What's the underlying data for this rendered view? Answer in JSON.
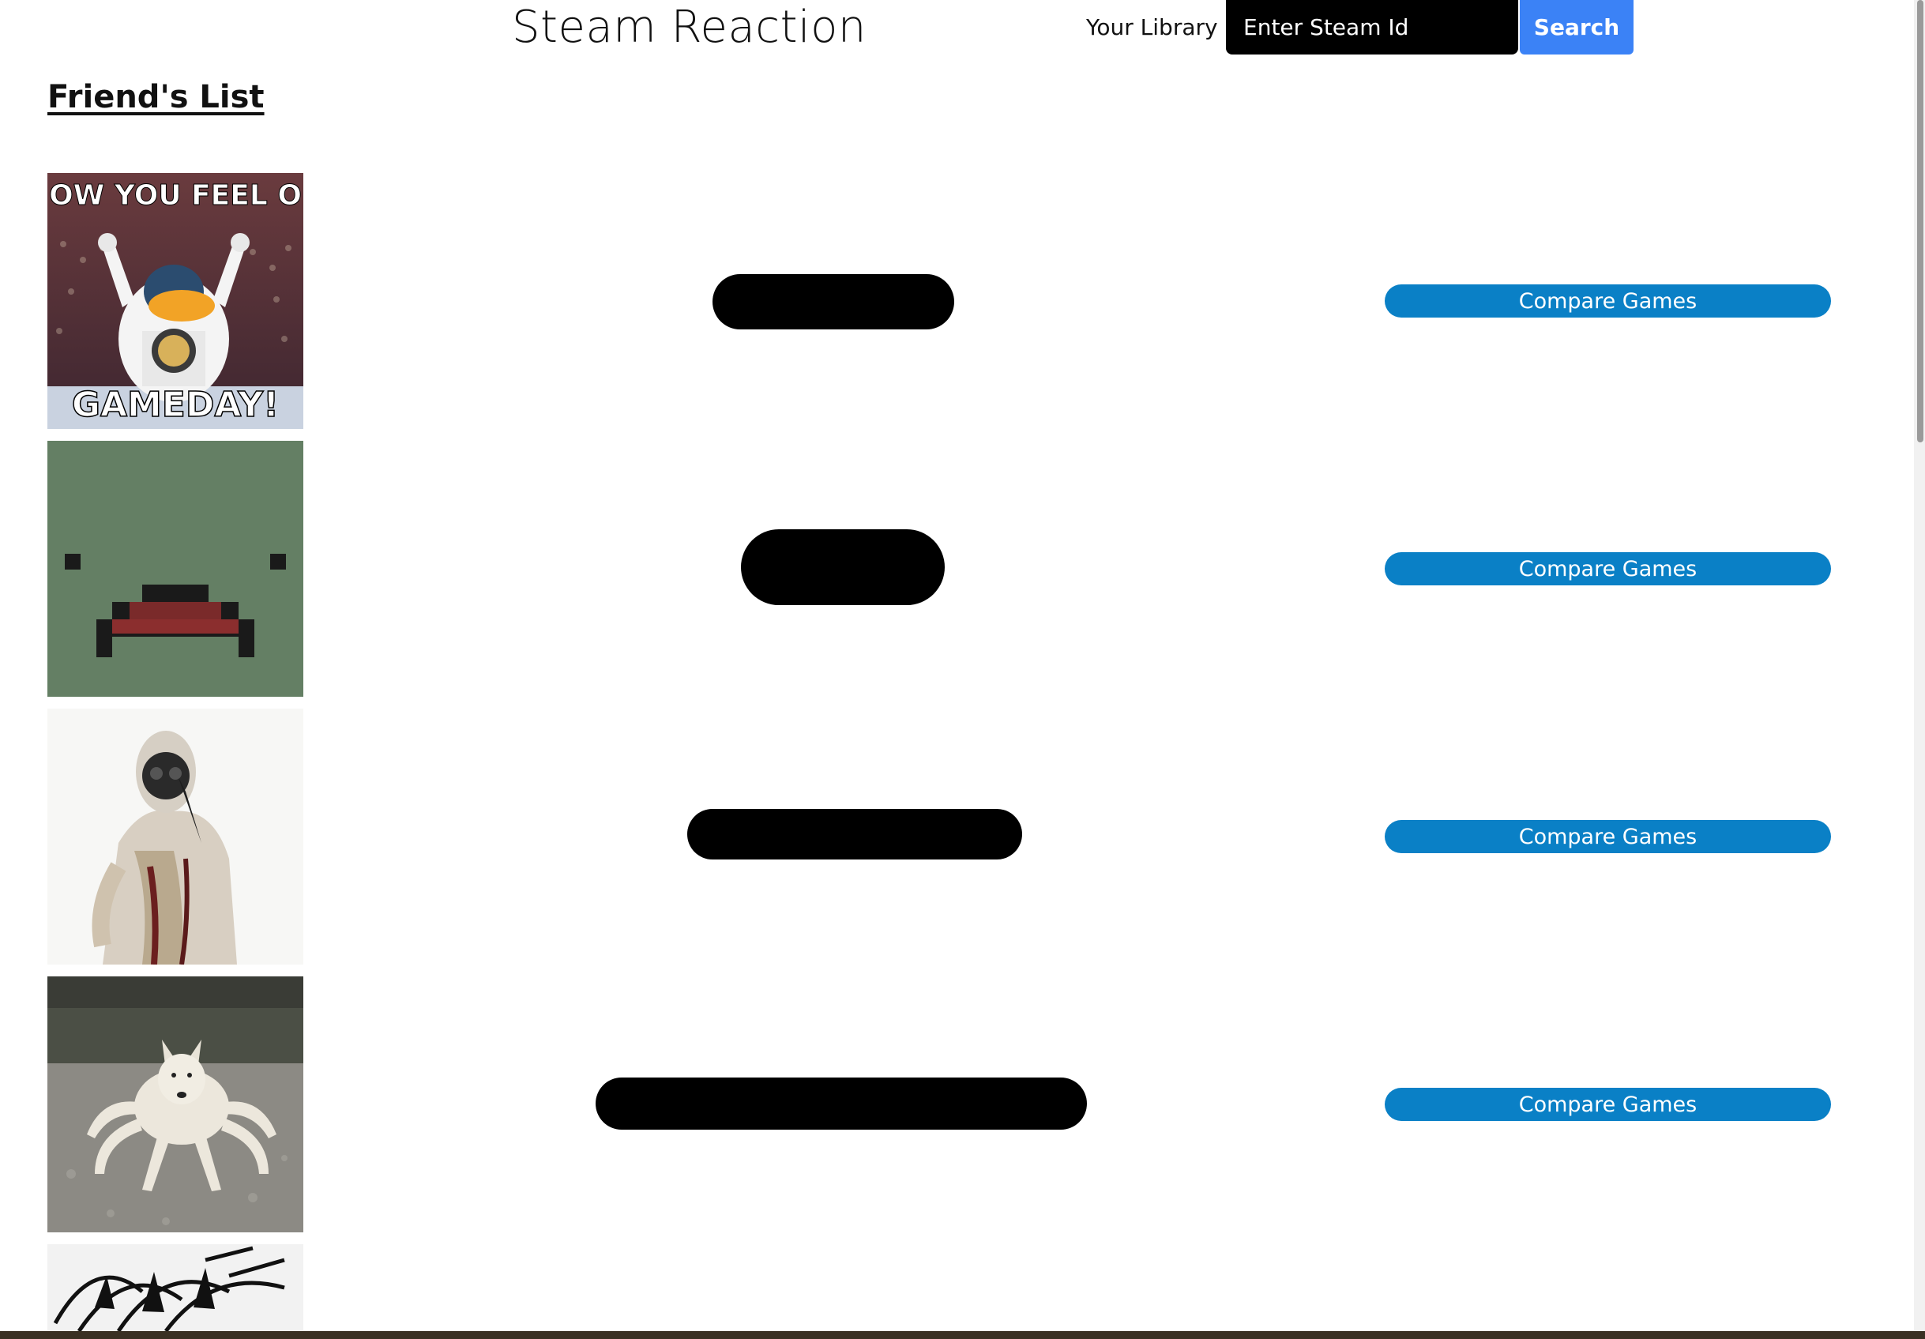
{
  "header": {
    "title": "Steam Reaction",
    "library_label": "Your Library",
    "search_placeholder": "Enter Steam Id",
    "search_button_label": "Search"
  },
  "friends": {
    "heading": "Friend's List",
    "items": [
      {
        "avatar_top_text": "HOW YOU FEEL ON",
        "avatar_bottom_text": "GAMEDAY!",
        "name": "[redacted]",
        "compare_label": "Compare Games"
      },
      {
        "name": "[redacted]",
        "compare_label": "Compare Games"
      },
      {
        "name": "[redacted]",
        "compare_label": "Compare Games"
      },
      {
        "name": "[redacted]",
        "compare_label": "Compare Games"
      },
      {
        "name": "[redacted]"
      }
    ]
  },
  "colors": {
    "search_button": "#3b82f6",
    "compare_button": "#0a80c6",
    "search_input_bg": "#000000"
  }
}
